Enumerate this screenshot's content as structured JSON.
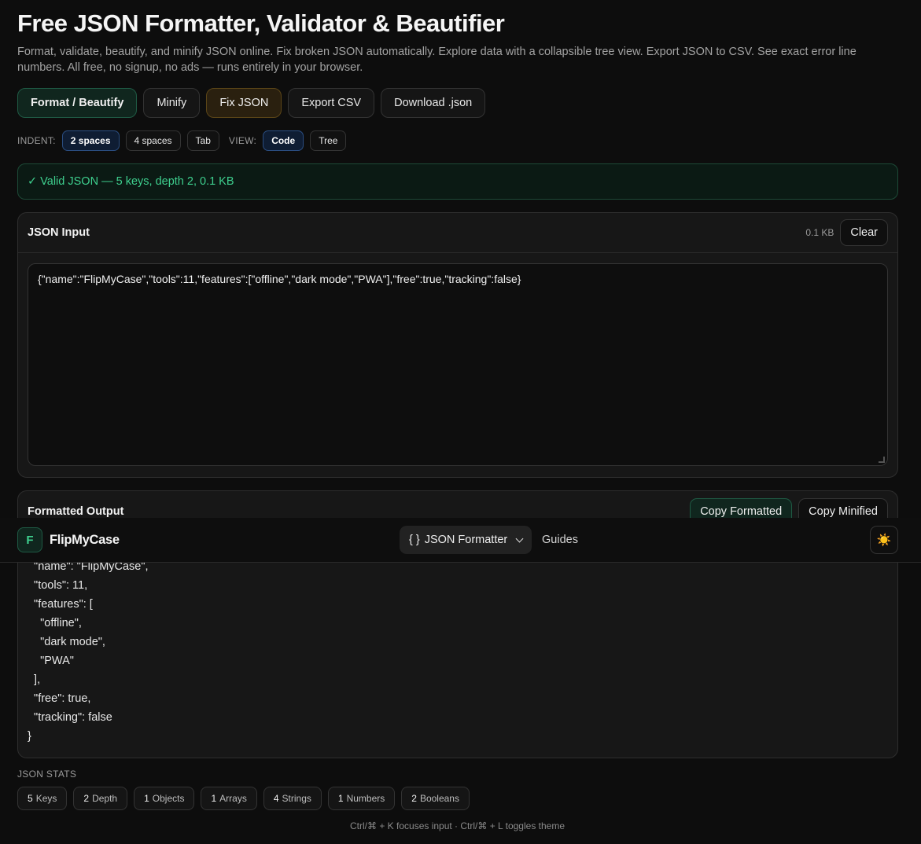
{
  "header": {
    "title": "Free JSON Formatter, Validator & Beautifier",
    "subtitle": "Format, validate, beautify, and minify JSON online. Fix broken JSON automatically. Explore data with a collapsible tree view. Export JSON to CSV. See exact error line numbers. All free, no signup, no ads — runs entirely in your browser."
  },
  "actions": {
    "format": "Format / Beautify",
    "minify": "Minify",
    "fix": "Fix JSON",
    "export_csv": "Export CSV",
    "download": "Download .json"
  },
  "options": {
    "indent_label": "INDENT:",
    "indent_options": [
      "2 spaces",
      "4 spaces",
      "Tab"
    ],
    "indent_selected": "2 spaces",
    "view_label": "VIEW:",
    "view_options": [
      "Code",
      "Tree"
    ],
    "view_selected": "Code"
  },
  "status": {
    "message": "✓ Valid JSON — 5 keys, depth 2, 0.1 KB",
    "color": "#3ecf8e"
  },
  "input_panel": {
    "title": "JSON Input",
    "size": "0.1 KB",
    "clear_label": "Clear",
    "value": "{\"name\":\"FlipMyCase\",\"tools\":11,\"features\":[\"offline\",\"dark mode\",\"PWA\"],\"free\":true,\"tracking\":false}"
  },
  "output_panel": {
    "title": "Formatted Output",
    "copy_formatted": "Copy Formatted",
    "copy_minified": "Copy Minified",
    "lines": [
      "  \"name\": \"FlipMyCase\",",
      "  \"tools\": 11,",
      "  \"features\": [",
      "    \"offline\",",
      "    \"dark mode\",",
      "    \"PWA\"",
      "  ],",
      "  \"free\": true,",
      "  \"tracking\": false",
      "}"
    ]
  },
  "navbar": {
    "logo_letter": "F",
    "brand": "FlipMyCase",
    "tool_icon": "{ }",
    "tool_label": "JSON Formatter",
    "guides": "Guides",
    "theme_icon": "☀️"
  },
  "stats": {
    "label": "JSON STATS",
    "items": [
      {
        "value": "5",
        "label": "Keys"
      },
      {
        "value": "2",
        "label": "Depth"
      },
      {
        "value": "1",
        "label": "Objects"
      },
      {
        "value": "1",
        "label": "Arrays"
      },
      {
        "value": "4",
        "label": "Strings"
      },
      {
        "value": "1",
        "label": "Numbers"
      },
      {
        "value": "2",
        "label": "Booleans"
      }
    ]
  },
  "footer": "Ctrl/⌘ + K focuses input · Ctrl/⌘ + L toggles theme",
  "colors": {
    "accent": "#3ecf8e",
    "background": "#0d0d0d"
  }
}
